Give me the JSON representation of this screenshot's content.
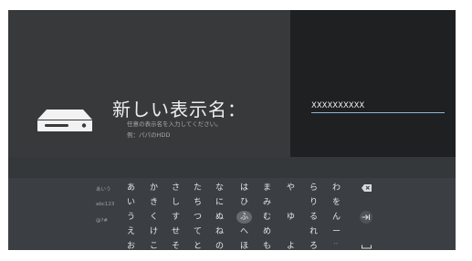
{
  "dialog": {
    "title": "新しい表示名：",
    "hint": "任意の表示名を入力してください。",
    "example": "例：パパのHDD"
  },
  "input": {
    "value": "XXXXXXXXXX"
  },
  "keyboard": {
    "modes": [
      "あいう",
      "abc123",
      "@?#"
    ],
    "rows": [
      [
        "あ",
        "か",
        "さ",
        "た",
        "な",
        "は",
        "ま",
        "や",
        "ら",
        "わ"
      ],
      [
        "い",
        "き",
        "し",
        "ち",
        "に",
        "ひ",
        "み",
        "",
        "り",
        "を"
      ],
      [
        "う",
        "く",
        "す",
        "つ",
        "ぬ",
        "ふ",
        "む",
        "ゆ",
        "る",
        "ん"
      ],
      [
        "え",
        "け",
        "せ",
        "て",
        "ね",
        "へ",
        "め",
        "",
        "れ",
        "ー"
      ],
      [
        "お",
        "こ",
        "そ",
        "と",
        "の",
        "ほ",
        "も",
        "よ",
        "ろ",
        "ﾞﾟ"
      ]
    ],
    "focused_key": "ふ",
    "actions": [
      {
        "name": "backspace-icon"
      },
      {
        "name": "next-field-icon"
      },
      {
        "name": "space-icon"
      }
    ]
  }
}
